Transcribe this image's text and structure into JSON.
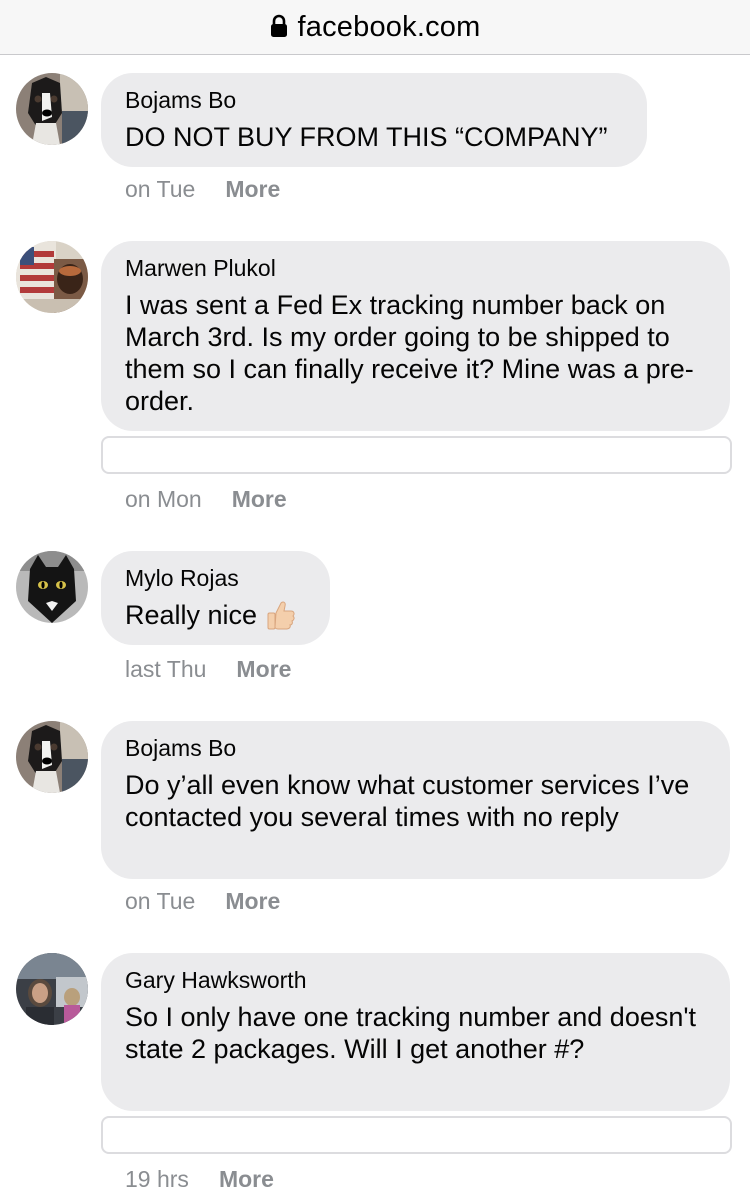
{
  "browser": {
    "domain": "facebook.com",
    "lock_icon": "lock-icon"
  },
  "comments": [
    {
      "author": "Bojams Bo",
      "text": "DO NOT BUY FROM THIS “COMPANY”",
      "time": "on Tue",
      "action": "More",
      "avatar": "dog-avatar"
    },
    {
      "author": "Marwen Plukol",
      "text": "I was sent a Fed Ex tracking number back on March 3rd. Is my order going to be shipped to them so I can finally receive it? Mine was a pre-order.",
      "time": "on Mon",
      "action": "More",
      "avatar": "flag-avatar"
    },
    {
      "author": "Mylo Rojas",
      "text": "Really nice",
      "time": "last Thu",
      "action": "More",
      "avatar": "cat-avatar",
      "emoji": "thumbs-up-icon"
    },
    {
      "author": "Bojams Bo",
      "text": "Do y’all even know what customer services I’ve contacted you several times with no reply",
      "time": "on Tue",
      "action": "More",
      "avatar": "dog-avatar"
    },
    {
      "author": "Gary Hawksworth",
      "text": "So I only have one tracking number and doesn't state 2 packages. Will I get another #?",
      "time": "19 hrs",
      "action": "More",
      "avatar": "car-photo-avatar"
    }
  ],
  "colors": {
    "bubble": "#ebebed",
    "meta_text": "#8a8d91",
    "address_bar": "#f7f7f7"
  }
}
